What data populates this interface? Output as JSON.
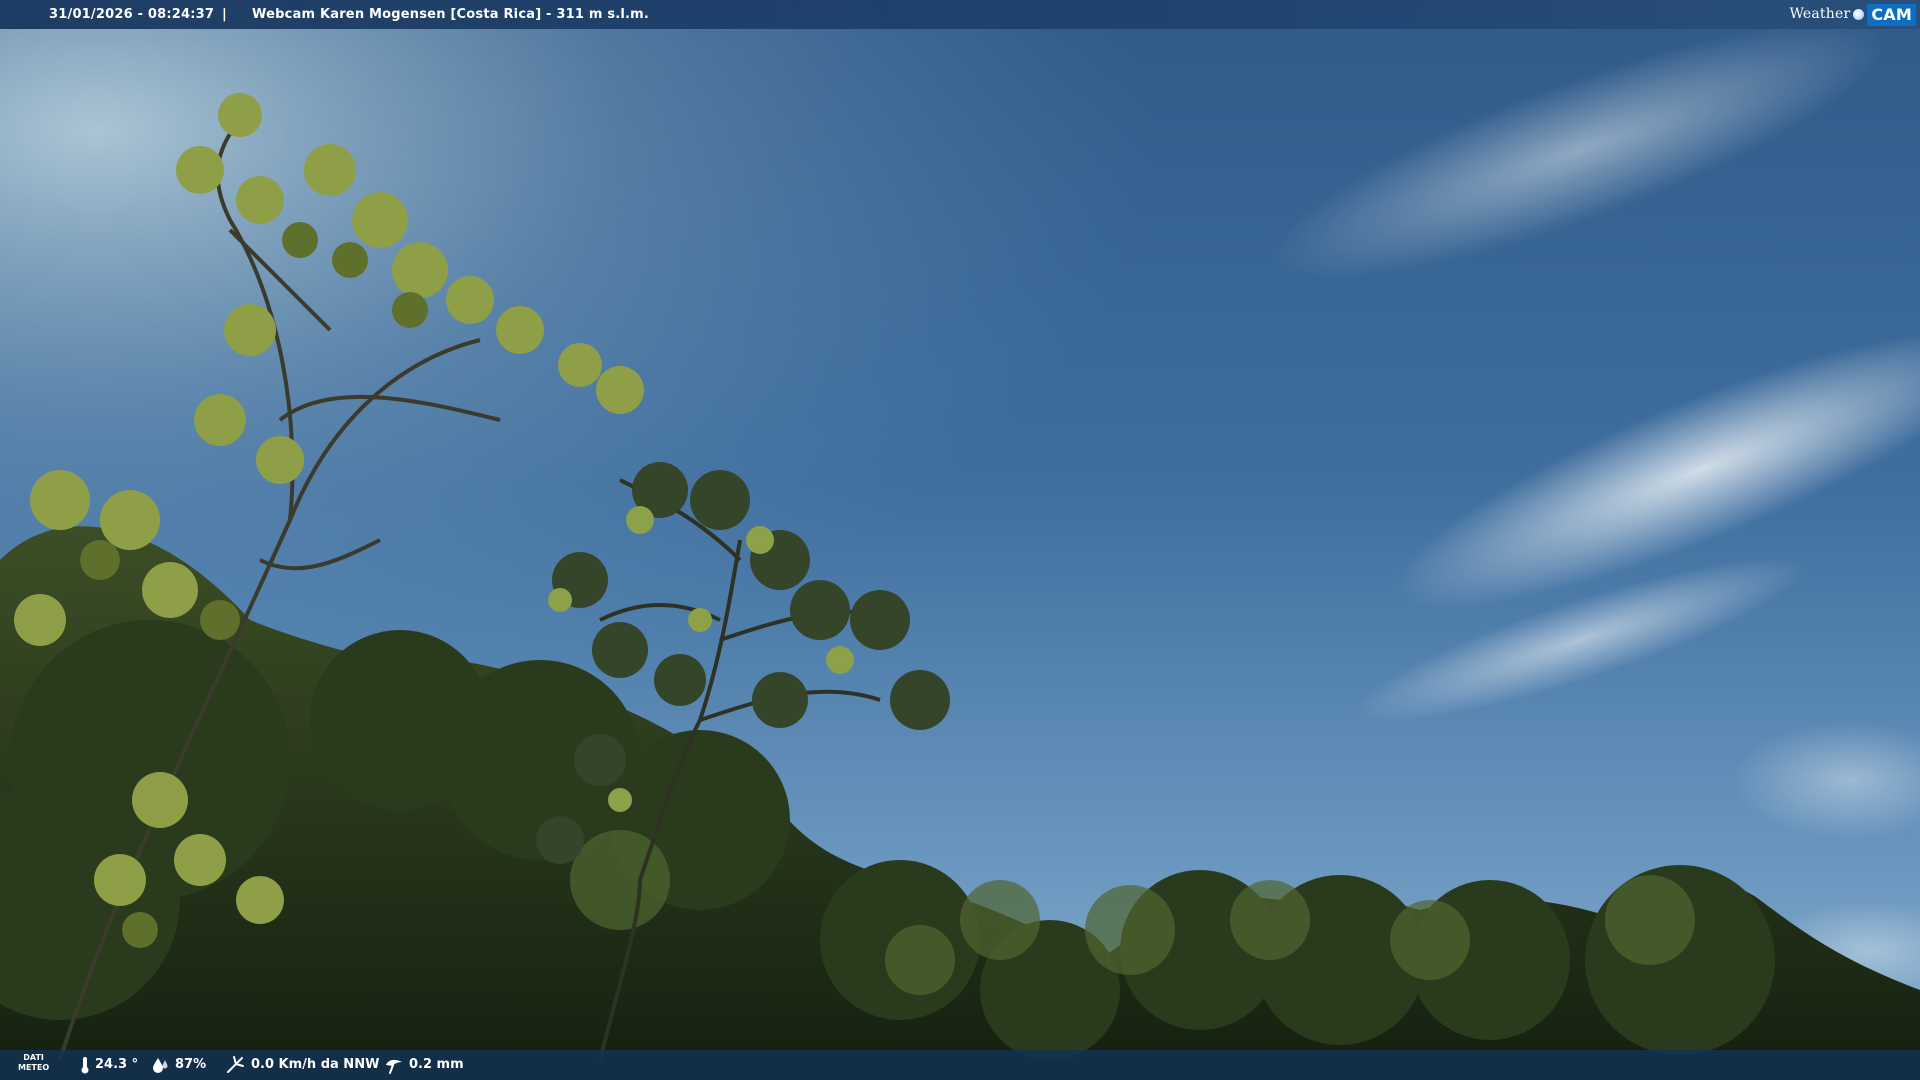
{
  "header": {
    "timestamp": "31/01/2026 - 08:24:37",
    "separator": "|",
    "title": "Webcam Karen Mogensen [Costa Rica] - 311 m s.l.m."
  },
  "brand": {
    "weather": "Weather",
    "cam": "CAM"
  },
  "footer": {
    "dati_line1": "DATI",
    "dati_line2": "METEO",
    "temperature": "24.3 °",
    "humidity": "87%",
    "wind": "0.0 Km/h da NNW",
    "rain": "0.2 mm"
  },
  "colors": {
    "sky_top": "#2e5a8a",
    "sky_horizon": "#7fa9c9",
    "foliage_dark": "#1e2b18",
    "foliage_light": "#8aa04a",
    "bar_blue": "#16345c",
    "brand_blue": "#0c6fc4"
  },
  "icons": [
    "thermometer-icon",
    "humidity-drop-icon",
    "wind-icon",
    "rain-icon",
    "weathercam-logo"
  ]
}
